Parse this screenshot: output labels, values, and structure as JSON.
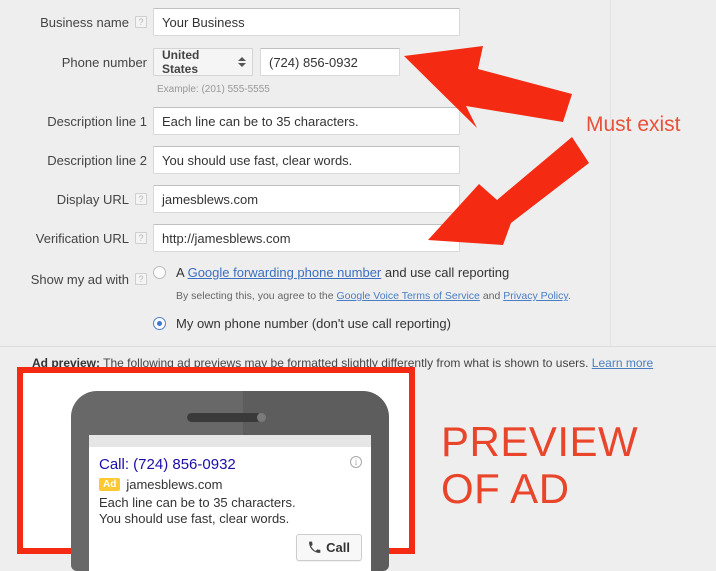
{
  "form": {
    "fields": [
      {
        "label": "Business name",
        "has_help": true,
        "value": "Your Business"
      },
      {
        "label": "Phone number",
        "has_help": false,
        "value": "(724) 856-0932"
      },
      {
        "label": "Description line 1",
        "has_help": false,
        "value": "Each line can be to 35 characters."
      },
      {
        "label": "Description line 2",
        "has_help": false,
        "value": "You should use fast, clear words."
      },
      {
        "label": "Display URL",
        "has_help": true,
        "value": "jamesblews.com"
      },
      {
        "label": "Verification URL",
        "has_help": true,
        "value": "http://jamesblews.com"
      }
    ],
    "country_select": {
      "value": "United States",
      "icon": "updown-chevron-icon"
    },
    "phone_example": "Example: (201) 555-5555",
    "show_ad_with": {
      "label": "Show my ad with",
      "has_help": true,
      "options": [
        {
          "selected": false,
          "prefix": "A ",
          "link": "Google forwarding phone number",
          "suffix": " and use call reporting",
          "note_prefix": "By selecting this, you agree to the ",
          "note_link1": "Google Voice Terms of Service",
          "note_mid": " and ",
          "note_link2": "Privacy Policy",
          "note_suffix": "."
        },
        {
          "selected": true,
          "prefix": "My own phone number (don't use call reporting)",
          "link": "",
          "suffix": ""
        }
      ]
    },
    "help_glyph": "?"
  },
  "ad_preview": {
    "heading": "Ad preview:",
    "description": " The following ad previews may be formatted slightly differently from what is shown to users. ",
    "learn_more": "Learn more",
    "card": {
      "title": "Call: (724) 856-0932",
      "badge": "Ad",
      "url": "jamesblews.com",
      "desc_line1": "Each line can be to 35 characters.",
      "desc_line2": "You should use fast, clear words.",
      "call_button": "Call",
      "call_icon": "phone-handset-icon",
      "info_icon": "info-circle-icon"
    }
  },
  "annotations": {
    "must_exist": "Must exist",
    "preview_of_ad_line1": "PREVIEW",
    "preview_of_ad_line2": "OF AD",
    "arrow_color": "#f42a12",
    "text_color": "#e8452b"
  }
}
